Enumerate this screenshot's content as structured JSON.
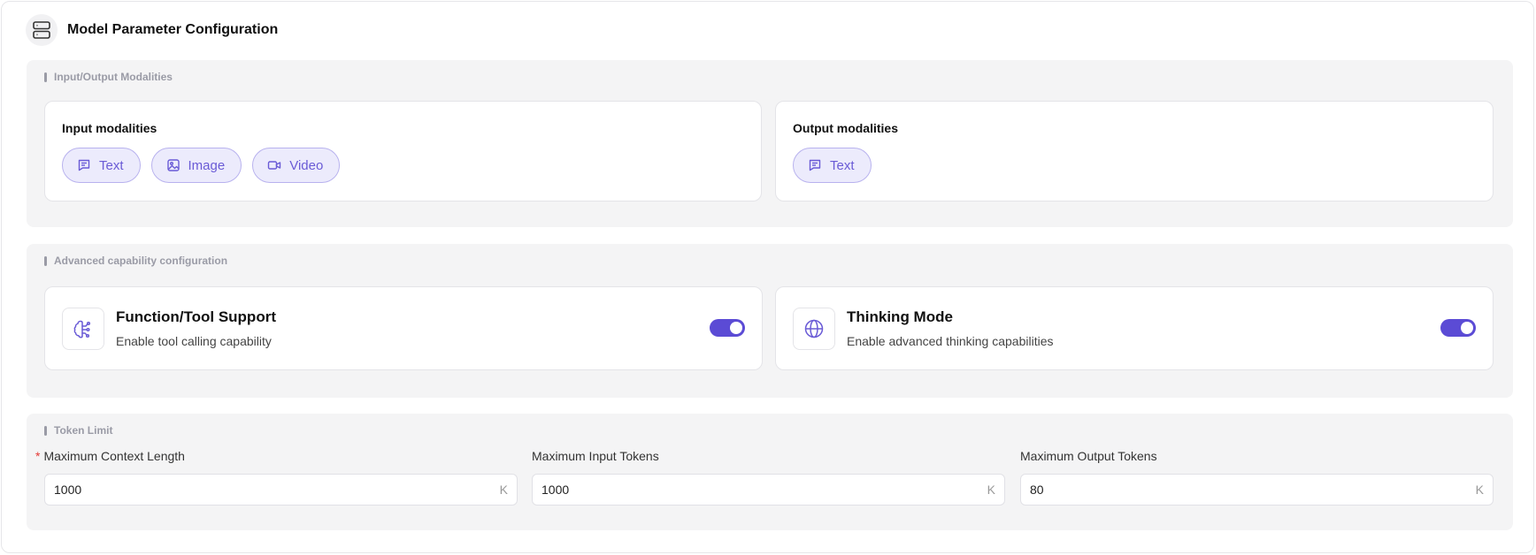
{
  "header": {
    "title": "Model Parameter Configuration",
    "icon": "server-icon"
  },
  "modalities": {
    "section_label": "Input/Output Modalities",
    "input": {
      "title": "Input modalities",
      "chips": [
        {
          "label": "Text",
          "icon": "text-icon"
        },
        {
          "label": "Image",
          "icon": "image-icon"
        },
        {
          "label": "Video",
          "icon": "video-icon"
        }
      ]
    },
    "output": {
      "title": "Output modalities",
      "chips": [
        {
          "label": "Text",
          "icon": "text-icon"
        }
      ]
    }
  },
  "advanced": {
    "section_label": "Advanced capability configuration",
    "function_tool": {
      "title": "Function/Tool Support",
      "description": "Enable tool calling capability",
      "enabled": true,
      "icon": "brain-icon"
    },
    "thinking": {
      "title": "Thinking Mode",
      "description": "Enable advanced thinking capabilities",
      "enabled": true,
      "icon": "globe-icon"
    }
  },
  "tokens": {
    "section_label": "Token Limit",
    "required_marker": "*",
    "fields": [
      {
        "label": "Maximum Context Length",
        "value": "1000",
        "suffix": "K",
        "required": true
      },
      {
        "label": "Maximum Input Tokens",
        "value": "1000",
        "suffix": "K",
        "required": false
      },
      {
        "label": "Maximum Output Tokens",
        "value": "80",
        "suffix": "K",
        "required": false
      }
    ]
  },
  "colors": {
    "accent": "#5b4bd5",
    "chip_bg": "#ecebfc",
    "chip_border": "#b8b2ee",
    "section_bg": "#f4f4f5"
  }
}
